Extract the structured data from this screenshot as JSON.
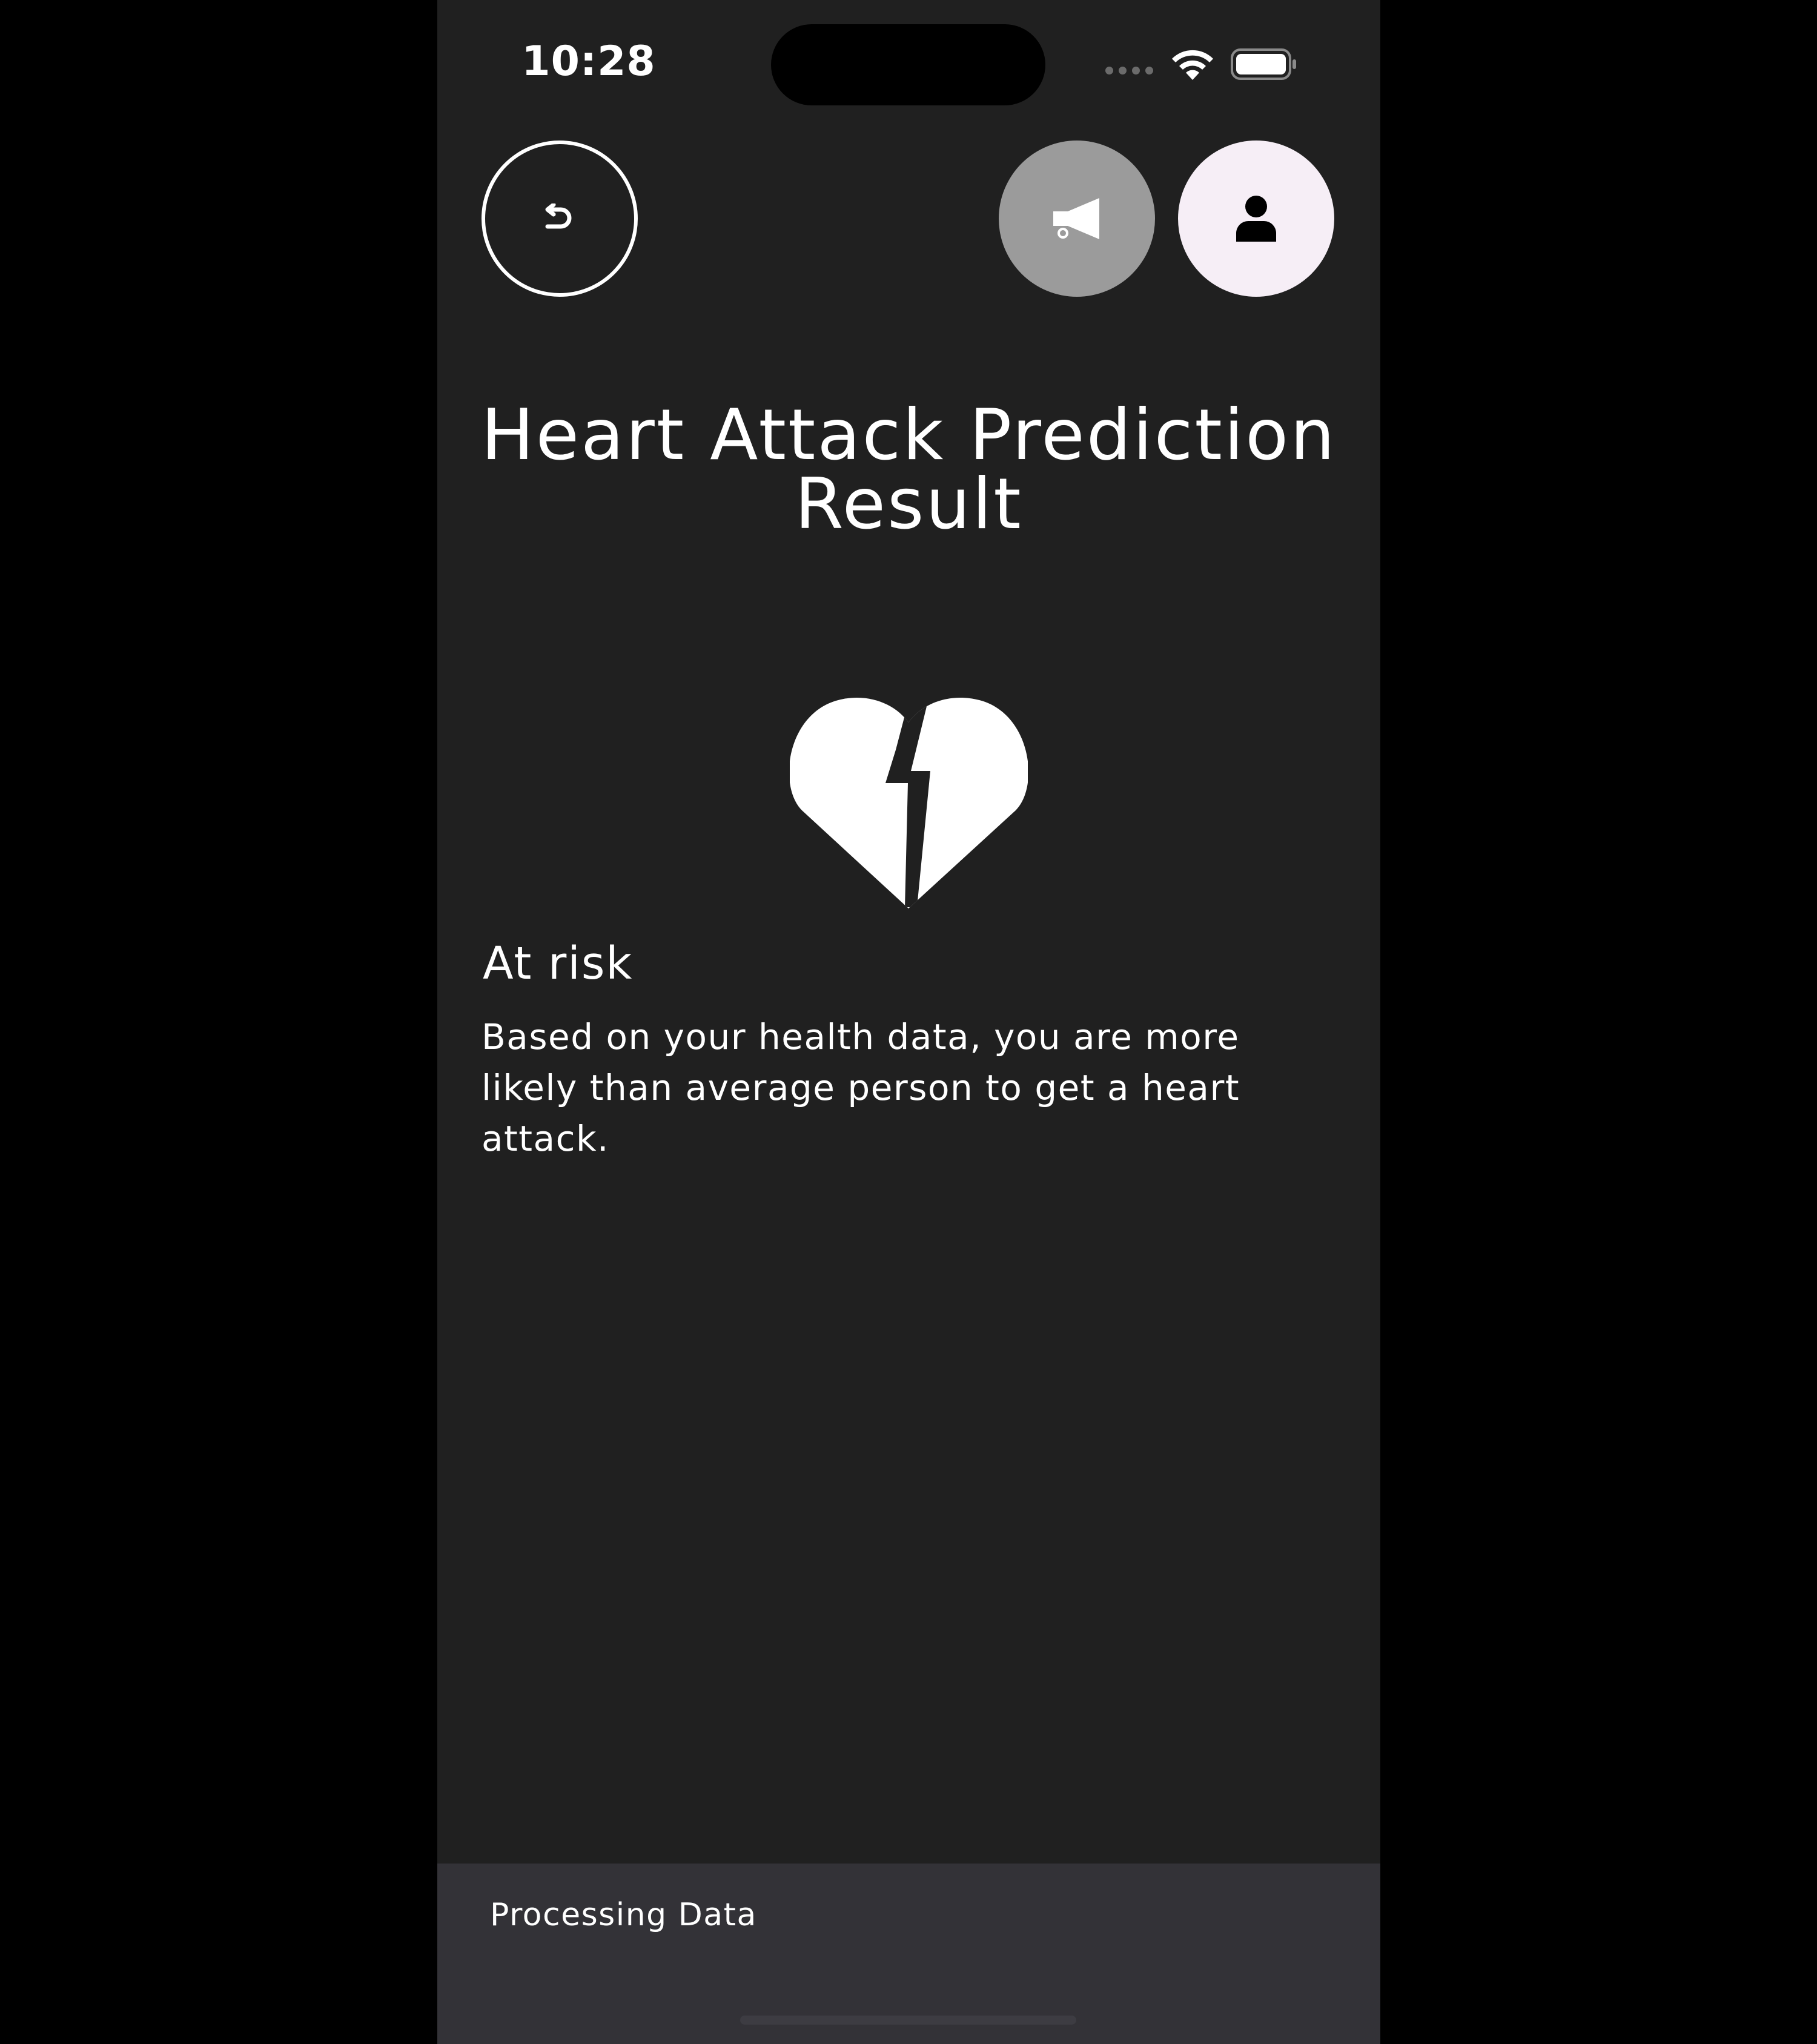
{
  "status_bar": {
    "time": "10:28"
  },
  "header": {
    "back_icon": "back-arrow-icon",
    "announce_icon": "megaphone-icon",
    "profile_icon": "person-icon"
  },
  "main": {
    "title": "Heart Attack Prediction Result",
    "result_icon": "broken-heart-icon",
    "risk_label": "At risk",
    "risk_description": "Based on your health data, you are more likely than average person to get a heart attack."
  },
  "snackbar": {
    "message": "Processing Data"
  },
  "colors": {
    "background": "#202020",
    "snackbar": "#333237",
    "announce_button": "#9b9b9b",
    "profile_button": "#f6eef6",
    "text": "#ffffff"
  }
}
